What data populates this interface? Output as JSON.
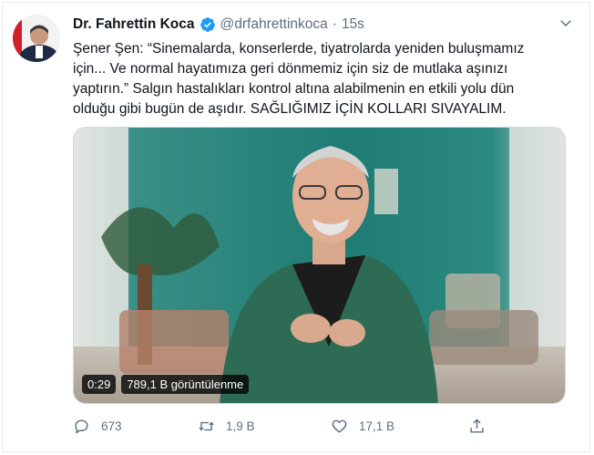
{
  "tweet": {
    "author_name": "Dr. Fahrettin Koca",
    "handle": "@drfahrettinkoca",
    "separator": "·",
    "time": "15s",
    "text_lines": [
      "Şener Şen: “Sinemalarda, konserlerde, tiyatrolarda yeniden buluşmamız",
      "için... Ve normal hayatımıza geri dönmemiz için siz de mutlaka aşınızı",
      "yaptırın.” Salgın hastalıkları kontrol altına alabilmenin en etkili yolu dün",
      "olduğu gibi bugün de aşıdır. SAĞLIĞIMIZ İÇİN KOLLARI SIVAYALIM."
    ]
  },
  "video": {
    "duration": "0:29",
    "views": "789,1 B görüntülenme"
  },
  "actions": {
    "reply_count": "673",
    "retweet_count": "1,9 B",
    "like_count": "17,1 B"
  },
  "icons": {
    "verified": "verified-badge-icon",
    "more": "chevron-down-icon",
    "reply": "reply-icon",
    "retweet": "retweet-icon",
    "like": "heart-icon",
    "share": "share-icon"
  },
  "colors": {
    "accent": "#1d9bf0",
    "secondary_text": "#5b7083"
  }
}
